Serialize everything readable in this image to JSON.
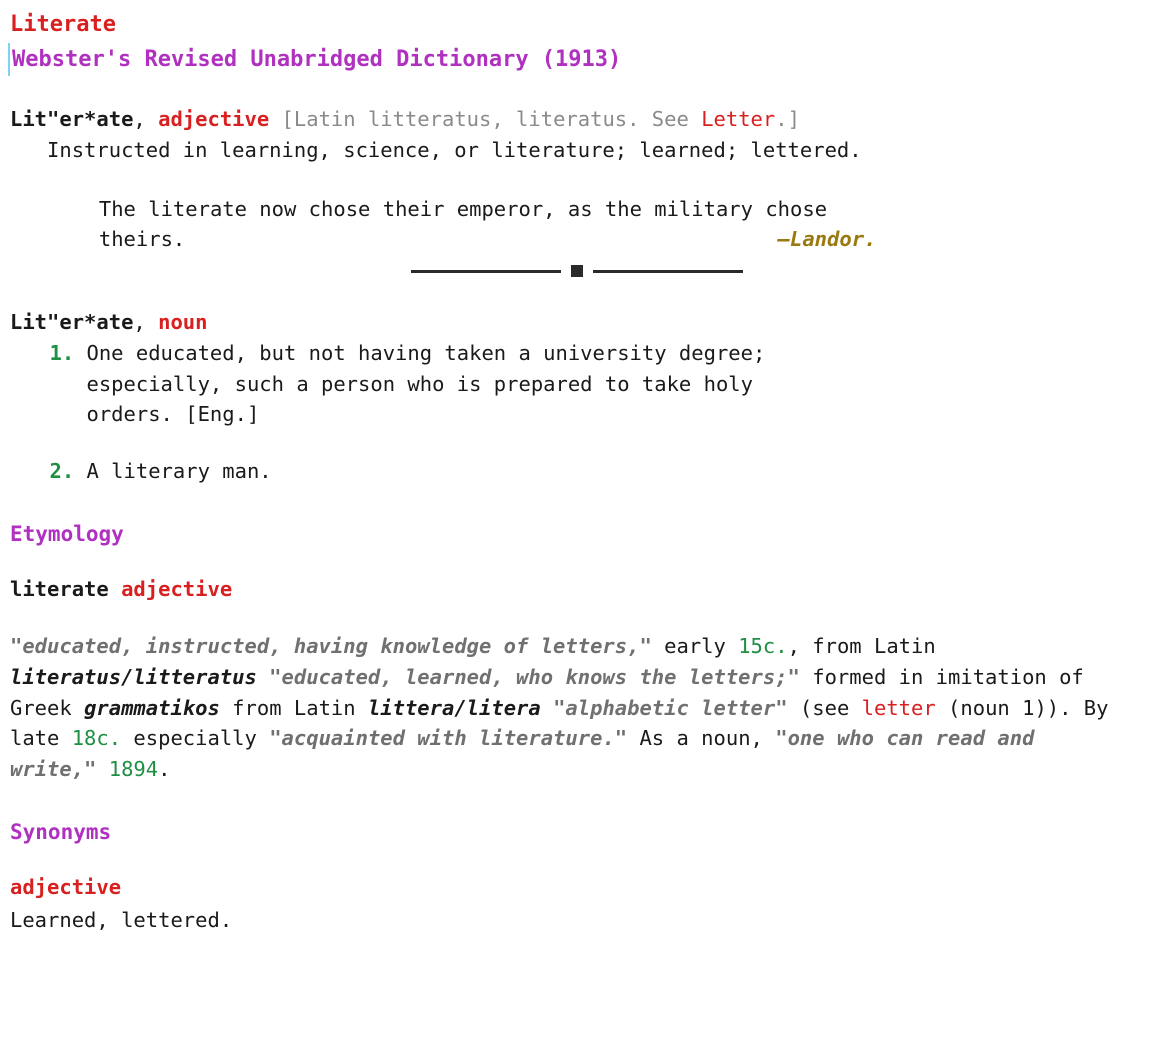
{
  "title": "Literate",
  "source": "Webster's Revised Unabridged Dictionary (1913)",
  "adj_entry": {
    "hw": "Lit\"er*ate",
    "comma": ", ",
    "pos": "adjective",
    "bracket_open": " [",
    "etym_pre": "Latin litteratus, literatus. See ",
    "etym_link": "Letter",
    "etym_post": ".",
    "bracket_close": "]",
    "def": "Instructed in learning, science, or literature; learned; lettered.",
    "quote": "The literate now chose their emperor, as the military chose theirs.",
    "quote_attr": "—Landor."
  },
  "noun_entry": {
    "hw": "Lit\"er*ate",
    "comma": ", ",
    "pos": "noun",
    "items": [
      {
        "num": "1.",
        "def": "One educated, but not having taken a university degree; especially, such a person who is prepared to take holy orders. [Eng.]"
      },
      {
        "num": "2.",
        "def": "A literary man."
      }
    ]
  },
  "etymology": {
    "heading": "Etymology",
    "hw": "literate",
    "pos": "adjective",
    "p": {
      "g1": "\"educated, instructed, having knowledge of letters,\"",
      "t1": " early ",
      "d1": "15c.",
      "t2": ", from Latin ",
      "lat1": "literatus/litteratus",
      "g2": " \"educated, learned, who knows the letters;\"",
      "t3": " formed in imitation of Greek ",
      "lat2": "grammatikos",
      "t4": " from Latin ",
      "lat3": "littera/litera",
      "g3": " \"alphabetic letter\"",
      "t5": " (see ",
      "link": "letter",
      "t6": " (noun 1)). By late ",
      "d2": "18c.",
      "t7": " especially ",
      "g4": "\"acquainted with literature.\"",
      "t8": " As a noun, ",
      "g5": "\"one who can read and write,\"",
      "t9": " ",
      "d3": "1894",
      "t10": "."
    }
  },
  "synonyms": {
    "heading": "Synonyms",
    "pos": "adjective",
    "list": "Learned, lettered."
  }
}
